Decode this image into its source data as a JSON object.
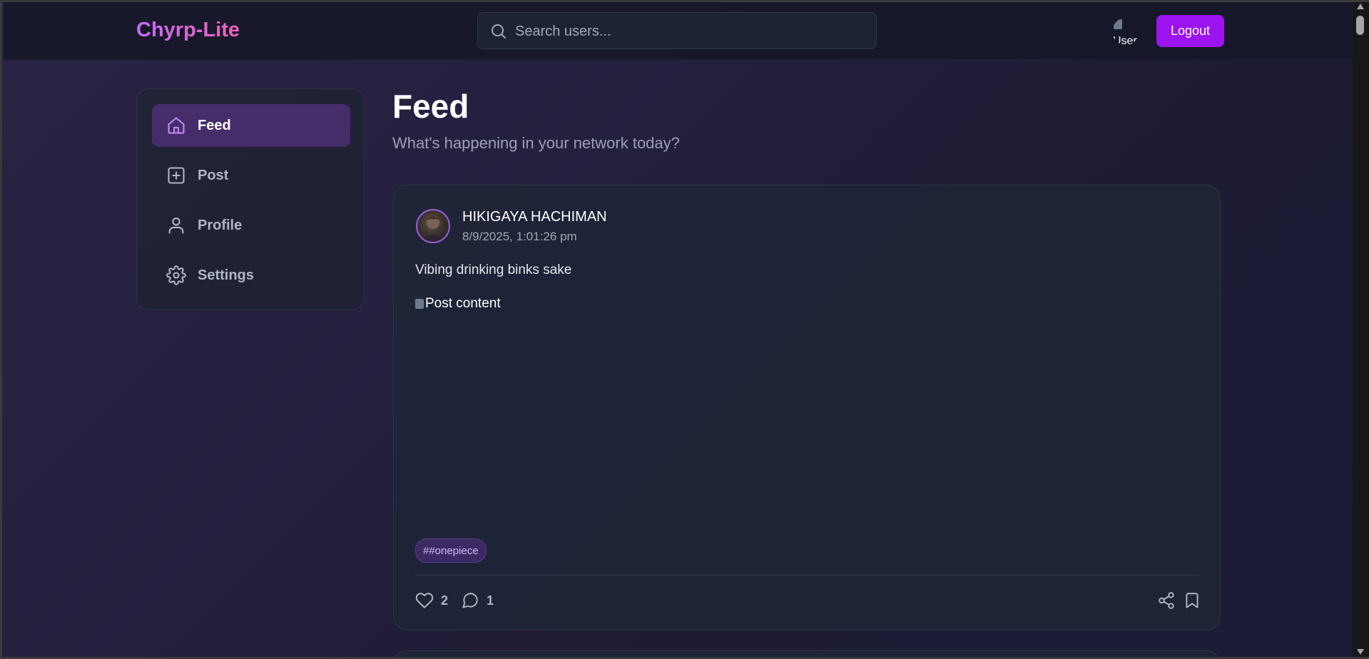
{
  "app": {
    "brand": "Chyrp-Lite"
  },
  "header": {
    "search_placeholder": "Search users...",
    "avatar_alt": "User",
    "logout_label": "Logout"
  },
  "sidebar": {
    "items": [
      {
        "label": "Feed",
        "icon": "home-icon",
        "active": true
      },
      {
        "label": "Post",
        "icon": "plus-square-icon",
        "active": false
      },
      {
        "label": "Profile",
        "icon": "user-icon",
        "active": false
      },
      {
        "label": "Settings",
        "icon": "gear-icon",
        "active": false
      }
    ]
  },
  "main": {
    "title": "Feed",
    "subtitle": "What's happening in your network today?"
  },
  "posts": [
    {
      "author": "HIKIGAYA HACHIMAN",
      "timestamp": "8/9/2025, 1:01:26 pm",
      "text": "Vibing drinking binks sake",
      "image_alt": "Post content",
      "tag": "##onepiece",
      "likes": "2",
      "comments": "1"
    }
  ],
  "colors": {
    "accent": "#9b14f0",
    "active_nav": "#452d6a",
    "brand_gradient_start": "#c16cf5",
    "brand_gradient_end": "#f062b8"
  }
}
